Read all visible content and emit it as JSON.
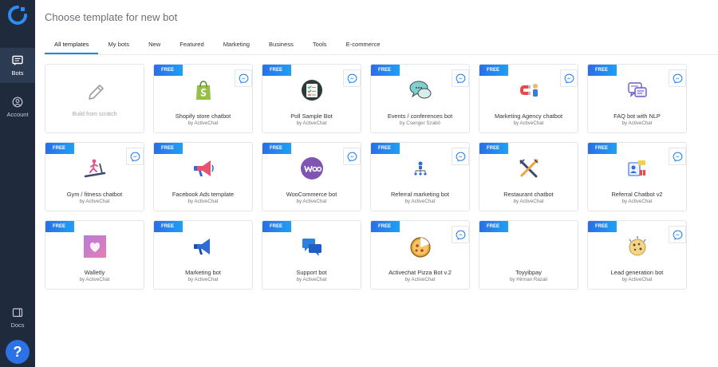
{
  "sidebar": {
    "items": [
      {
        "label": "Bots",
        "icon": "chat-icon"
      },
      {
        "label": "Account",
        "icon": "user-circle-icon"
      },
      {
        "label": "Docs",
        "icon": "book-icon"
      }
    ],
    "help_label": "?"
  },
  "page": {
    "title": "Choose template for new bot"
  },
  "tabs": [
    {
      "label": "All templates",
      "active": true
    },
    {
      "label": "My bots"
    },
    {
      "label": "New"
    },
    {
      "label": "Featured"
    },
    {
      "label": "Marketing"
    },
    {
      "label": "Business"
    },
    {
      "label": "Tools"
    },
    {
      "label": "E-commerce"
    }
  ],
  "badge_label": "FREE",
  "scratch_label": "Build from scratch",
  "templates": [
    {
      "title": "Shopify store chatbot",
      "author": "by ActiveChat",
      "icon": "shopify-bag-icon"
    },
    {
      "title": "Poll Sample Bot",
      "author": "by ActiveChat",
      "icon": "poll-checklist-icon"
    },
    {
      "title": "Events / conferences bot",
      "author": "by Csenger Szabó",
      "icon": "speech-bubbles-icon"
    },
    {
      "title": "Marketing Agency chatbot",
      "author": "by ActiveChat",
      "icon": "magnet-person-icon"
    },
    {
      "title": "FAQ bot with NLP",
      "author": "by ActiveChat",
      "icon": "faq-bubble-icon"
    },
    {
      "title": "Gym / fitness chatbot",
      "author": "by ActiveChat",
      "icon": "treadmill-icon"
    },
    {
      "title": "Facebook Ads template",
      "author": "by ActiveChat",
      "icon": "megaphone-icon"
    },
    {
      "title": "WooCommerce bot",
      "author": "by ActiveChat",
      "icon": "woocommerce-icon"
    },
    {
      "title": "Referral marketing bot",
      "author": "by ActiveChat",
      "icon": "referral-network-icon"
    },
    {
      "title": "Restaurant chatbot",
      "author": "by ActiveChat",
      "icon": "fork-knife-icon"
    },
    {
      "title": "Referral Chatbot v2",
      "author": "by ActiveChat",
      "icon": "gift-referral-icon"
    },
    {
      "title": "Walletly",
      "author": "by ActiveChat",
      "icon": "walletly-heart-icon"
    },
    {
      "title": "Marketing bot",
      "author": "by ActiveChat",
      "icon": "megaphone-blue-icon"
    },
    {
      "title": "Support bot",
      "author": "by ActiveChat",
      "icon": "chat-bubbles-blue-icon"
    },
    {
      "title": "Activechat Pizza Bot v.2",
      "author": "by ActiveChat",
      "icon": "pizza-icon"
    },
    {
      "title": "Toyyibpay",
      "author": "by Hirman Razali",
      "icon": "blank-icon"
    },
    {
      "title": "Lead generation bot",
      "author": "by ActiveChat",
      "icon": "cookie-icon"
    }
  ],
  "colors": {
    "sidebar_bg": "#1f2a3c",
    "accent": "#1e88e5",
    "badge_start": "#2a6ee8",
    "badge_end": "#1ea0f5"
  }
}
